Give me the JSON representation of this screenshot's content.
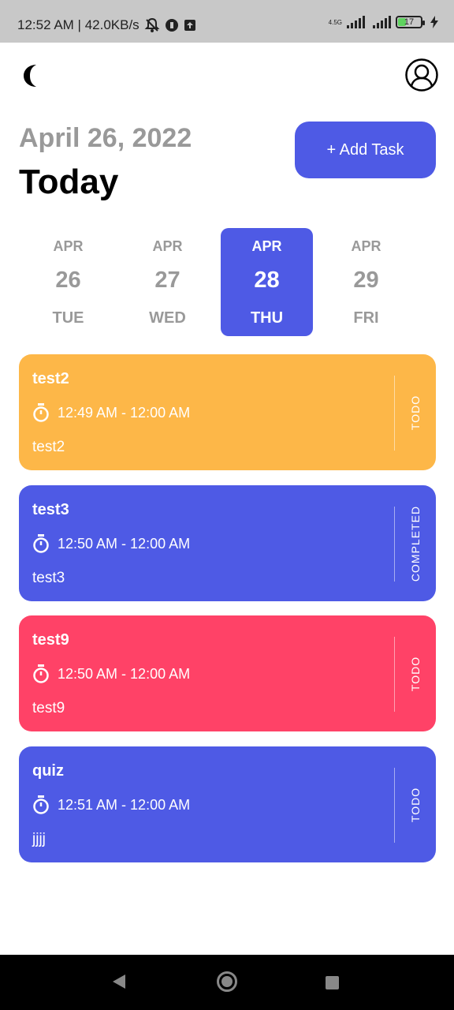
{
  "status_bar": {
    "time_speed": "12:52 AM | 42.0KB/s",
    "network_type": "4.5G",
    "battery_level": "17",
    "icons": [
      "bell-off-icon",
      "app-notification-icon",
      "upload-icon",
      "signal-icon",
      "signal-icon",
      "battery-icon",
      "charging-icon"
    ]
  },
  "header": {
    "theme_icon": "moon-icon",
    "profile_icon": "profile-icon"
  },
  "date_header": {
    "date": "April 26, 2022",
    "title": "Today",
    "add_task_label": "+ Add Task"
  },
  "date_strip": [
    {
      "month": "APR",
      "day": "26",
      "weekday": "TUE",
      "selected": false
    },
    {
      "month": "APR",
      "day": "27",
      "weekday": "WED",
      "selected": false
    },
    {
      "month": "APR",
      "day": "28",
      "weekday": "THU",
      "selected": true
    },
    {
      "month": "APR",
      "day": "29",
      "weekday": "FRI",
      "selected": false
    }
  ],
  "tasks": [
    {
      "title": "test2",
      "time": "12:49 AM - 12:00 AM",
      "note": "test2",
      "status": "TODO",
      "color": "#fdb748"
    },
    {
      "title": "test3",
      "time": "12:50 AM - 12:00 AM",
      "note": "test3",
      "status": "COMPLETED",
      "color": "#4e5ae5"
    },
    {
      "title": "test9",
      "time": "12:50 AM - 12:00 AM",
      "note": "test9",
      "status": "TODO",
      "color": "#ff4267"
    },
    {
      "title": "quiz",
      "time": "12:51 AM - 12:00 AM",
      "note": "jjjj",
      "status": "TODO",
      "color": "#4e5ae5"
    }
  ],
  "colors": {
    "accent": "#4e5ae5",
    "muted_text": "#999999"
  },
  "nav_bar": {
    "icons": [
      "back-icon",
      "home-icon",
      "recent-apps-icon"
    ]
  }
}
